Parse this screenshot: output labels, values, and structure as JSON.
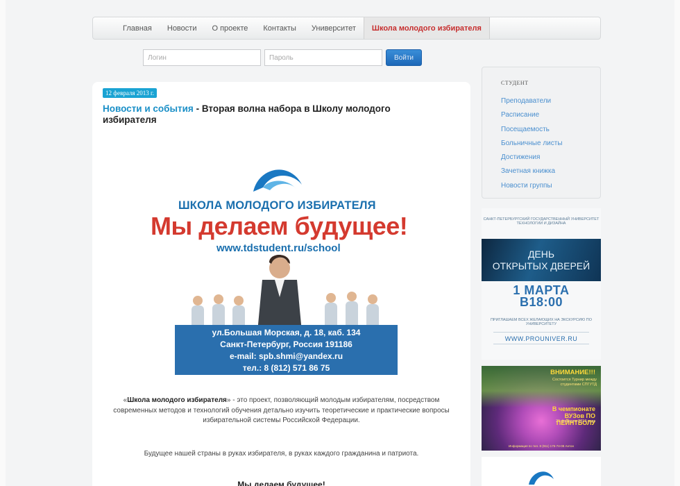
{
  "nav": {
    "items": [
      "Главная",
      "Новости",
      "О проекте",
      "Контакты",
      "Университет",
      "Школа молодого избирателя"
    ],
    "active_index": 5
  },
  "login": {
    "login_placeholder": "Логин",
    "password_placeholder": "Пароль",
    "submit_label": "Войти"
  },
  "article": {
    "date": "12 февраля 2013 г.",
    "category": "Новости и события",
    "title_separator": " - ",
    "title": "Вторая волна набора в Школу молодого избирателя",
    "poster": {
      "title": "ШКОЛА МОЛОДОГО ИЗБИРАТЕЛЯ",
      "slogan": "Мы делаем будущее!",
      "url": "www.tdstudent.ru/school",
      "address_line1": "ул.Большая Морская, д. 18, каб. 134",
      "address_line2": "Санкт-Петербург, Россия 191186",
      "email_line": "e-mail: spb.shmi@yandex.ru",
      "phone_line": "тел.: 8 (812) 571 86 75"
    },
    "desc_open_quote": "«",
    "desc_name": "Школа молодого избирателя",
    "desc_rest": "» - это проект, позволяющий молодым избирателям, посредством современных методов и технологий обучения детально изучить теоретические и практические вопросы избирательной системы Российской Федерации.",
    "paragraph2": "Будущее нашей страны в руках избирателя, в руках каждого гражданина и патриота.",
    "paragraph3": "Мы делаем будущее!"
  },
  "sidebar": {
    "title": "СТУДЕНТ",
    "links": [
      "Преподаватели",
      "Расписание",
      "Посещаемость",
      "Больничные листы",
      "Достижения",
      "Зачетная книжка",
      "Новости группы"
    ]
  },
  "banner1": {
    "org": "САНКТ-ПЕТЕРБУРГСКИЙ ГОСУДАРСТВЕННЫЙ УНИВЕРСИТЕТ ТЕХНОЛОГИИ И ДИЗАЙНА",
    "event_line1": "ДЕНЬ",
    "event_line2": "ОТКРЫТЫХ ДВЕРЕЙ",
    "date_line1": "1 МАРТА",
    "date_line2": "В18:00",
    "invite": "ПРИГЛАШАЕМ ВСЕХ ЖЕЛАЮЩИХ НА ЭКСКУРСИЮ ПО УНИВЕРСИТЕТУ",
    "url": "WWW.PROUNIVER.RU"
  },
  "banner2": {
    "title": "ВНИМАНИЕ!!!",
    "text": "Состоится Турнир между студентами СПГУТД",
    "big": "В чемпионате ВУЗов ПО ПЕЙНТБОЛУ",
    "date": "21 февраля 2013 года",
    "footer": "Информация по тел. 8 (911) 175-74-08 Антон"
  },
  "colors": {
    "accent_blue": "#1a8fc7",
    "active_nav_red": "#c62d2d",
    "link_blue": "#4a8fcf"
  }
}
